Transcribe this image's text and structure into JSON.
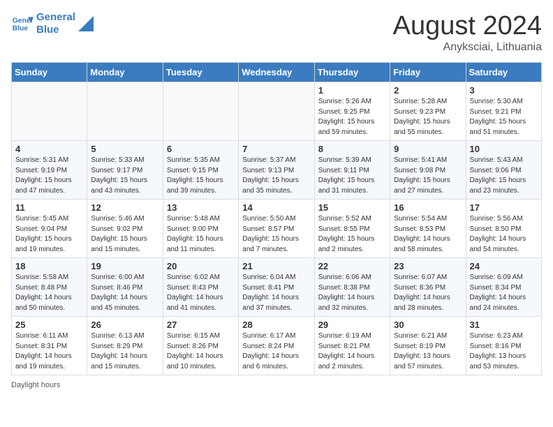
{
  "logo": {
    "line1": "General",
    "line2": "Blue"
  },
  "title": "August 2024",
  "subtitle": "Anyksciai, Lithuania",
  "days_of_week": [
    "Sunday",
    "Monday",
    "Tuesday",
    "Wednesday",
    "Thursday",
    "Friday",
    "Saturday"
  ],
  "footer": "Daylight hours",
  "weeks": [
    [
      {
        "day": "",
        "sunrise": "",
        "sunset": "",
        "daylight": "",
        "empty": true
      },
      {
        "day": "",
        "sunrise": "",
        "sunset": "",
        "daylight": "",
        "empty": true
      },
      {
        "day": "",
        "sunrise": "",
        "sunset": "",
        "daylight": "",
        "empty": true
      },
      {
        "day": "",
        "sunrise": "",
        "sunset": "",
        "daylight": "",
        "empty": true
      },
      {
        "day": "1",
        "sunrise": "Sunrise: 5:26 AM",
        "sunset": "Sunset: 9:25 PM",
        "daylight": "Daylight: 15 hours and 59 minutes.",
        "empty": false
      },
      {
        "day": "2",
        "sunrise": "Sunrise: 5:28 AM",
        "sunset": "Sunset: 9:23 PM",
        "daylight": "Daylight: 15 hours and 55 minutes.",
        "empty": false
      },
      {
        "day": "3",
        "sunrise": "Sunrise: 5:30 AM",
        "sunset": "Sunset: 9:21 PM",
        "daylight": "Daylight: 15 hours and 51 minutes.",
        "empty": false
      }
    ],
    [
      {
        "day": "4",
        "sunrise": "Sunrise: 5:31 AM",
        "sunset": "Sunset: 9:19 PM",
        "daylight": "Daylight: 15 hours and 47 minutes.",
        "empty": false
      },
      {
        "day": "5",
        "sunrise": "Sunrise: 5:33 AM",
        "sunset": "Sunset: 9:17 PM",
        "daylight": "Daylight: 15 hours and 43 minutes.",
        "empty": false
      },
      {
        "day": "6",
        "sunrise": "Sunrise: 5:35 AM",
        "sunset": "Sunset: 9:15 PM",
        "daylight": "Daylight: 15 hours and 39 minutes.",
        "empty": false
      },
      {
        "day": "7",
        "sunrise": "Sunrise: 5:37 AM",
        "sunset": "Sunset: 9:13 PM",
        "daylight": "Daylight: 15 hours and 35 minutes.",
        "empty": false
      },
      {
        "day": "8",
        "sunrise": "Sunrise: 5:39 AM",
        "sunset": "Sunset: 9:11 PM",
        "daylight": "Daylight: 15 hours and 31 minutes.",
        "empty": false
      },
      {
        "day": "9",
        "sunrise": "Sunrise: 5:41 AM",
        "sunset": "Sunset: 9:08 PM",
        "daylight": "Daylight: 15 hours and 27 minutes.",
        "empty": false
      },
      {
        "day": "10",
        "sunrise": "Sunrise: 5:43 AM",
        "sunset": "Sunset: 9:06 PM",
        "daylight": "Daylight: 15 hours and 23 minutes.",
        "empty": false
      }
    ],
    [
      {
        "day": "11",
        "sunrise": "Sunrise: 5:45 AM",
        "sunset": "Sunset: 9:04 PM",
        "daylight": "Daylight: 15 hours and 19 minutes.",
        "empty": false
      },
      {
        "day": "12",
        "sunrise": "Sunrise: 5:46 AM",
        "sunset": "Sunset: 9:02 PM",
        "daylight": "Daylight: 15 hours and 15 minutes.",
        "empty": false
      },
      {
        "day": "13",
        "sunrise": "Sunrise: 5:48 AM",
        "sunset": "Sunset: 9:00 PM",
        "daylight": "Daylight: 15 hours and 11 minutes.",
        "empty": false
      },
      {
        "day": "14",
        "sunrise": "Sunrise: 5:50 AM",
        "sunset": "Sunset: 8:57 PM",
        "daylight": "Daylight: 15 hours and 7 minutes.",
        "empty": false
      },
      {
        "day": "15",
        "sunrise": "Sunrise: 5:52 AM",
        "sunset": "Sunset: 8:55 PM",
        "daylight": "Daylight: 15 hours and 2 minutes.",
        "empty": false
      },
      {
        "day": "16",
        "sunrise": "Sunrise: 5:54 AM",
        "sunset": "Sunset: 8:53 PM",
        "daylight": "Daylight: 14 hours and 58 minutes.",
        "empty": false
      },
      {
        "day": "17",
        "sunrise": "Sunrise: 5:56 AM",
        "sunset": "Sunset: 8:50 PM",
        "daylight": "Daylight: 14 hours and 54 minutes.",
        "empty": false
      }
    ],
    [
      {
        "day": "18",
        "sunrise": "Sunrise: 5:58 AM",
        "sunset": "Sunset: 8:48 PM",
        "daylight": "Daylight: 14 hours and 50 minutes.",
        "empty": false
      },
      {
        "day": "19",
        "sunrise": "Sunrise: 6:00 AM",
        "sunset": "Sunset: 8:46 PM",
        "daylight": "Daylight: 14 hours and 45 minutes.",
        "empty": false
      },
      {
        "day": "20",
        "sunrise": "Sunrise: 6:02 AM",
        "sunset": "Sunset: 8:43 PM",
        "daylight": "Daylight: 14 hours and 41 minutes.",
        "empty": false
      },
      {
        "day": "21",
        "sunrise": "Sunrise: 6:04 AM",
        "sunset": "Sunset: 8:41 PM",
        "daylight": "Daylight: 14 hours and 37 minutes.",
        "empty": false
      },
      {
        "day": "22",
        "sunrise": "Sunrise: 6:06 AM",
        "sunset": "Sunset: 8:38 PM",
        "daylight": "Daylight: 14 hours and 32 minutes.",
        "empty": false
      },
      {
        "day": "23",
        "sunrise": "Sunrise: 6:07 AM",
        "sunset": "Sunset: 8:36 PM",
        "daylight": "Daylight: 14 hours and 28 minutes.",
        "empty": false
      },
      {
        "day": "24",
        "sunrise": "Sunrise: 6:09 AM",
        "sunset": "Sunset: 8:34 PM",
        "daylight": "Daylight: 14 hours and 24 minutes.",
        "empty": false
      }
    ],
    [
      {
        "day": "25",
        "sunrise": "Sunrise: 6:11 AM",
        "sunset": "Sunset: 8:31 PM",
        "daylight": "Daylight: 14 hours and 19 minutes.",
        "empty": false
      },
      {
        "day": "26",
        "sunrise": "Sunrise: 6:13 AM",
        "sunset": "Sunset: 8:29 PM",
        "daylight": "Daylight: 14 hours and 15 minutes.",
        "empty": false
      },
      {
        "day": "27",
        "sunrise": "Sunrise: 6:15 AM",
        "sunset": "Sunset: 8:26 PM",
        "daylight": "Daylight: 14 hours and 10 minutes.",
        "empty": false
      },
      {
        "day": "28",
        "sunrise": "Sunrise: 6:17 AM",
        "sunset": "Sunset: 8:24 PM",
        "daylight": "Daylight: 14 hours and 6 minutes.",
        "empty": false
      },
      {
        "day": "29",
        "sunrise": "Sunrise: 6:19 AM",
        "sunset": "Sunset: 8:21 PM",
        "daylight": "Daylight: 14 hours and 2 minutes.",
        "empty": false
      },
      {
        "day": "30",
        "sunrise": "Sunrise: 6:21 AM",
        "sunset": "Sunset: 8:19 PM",
        "daylight": "Daylight: 13 hours and 57 minutes.",
        "empty": false
      },
      {
        "day": "31",
        "sunrise": "Sunrise: 6:23 AM",
        "sunset": "Sunset: 8:16 PM",
        "daylight": "Daylight: 13 hours and 53 minutes.",
        "empty": false
      }
    ]
  ]
}
